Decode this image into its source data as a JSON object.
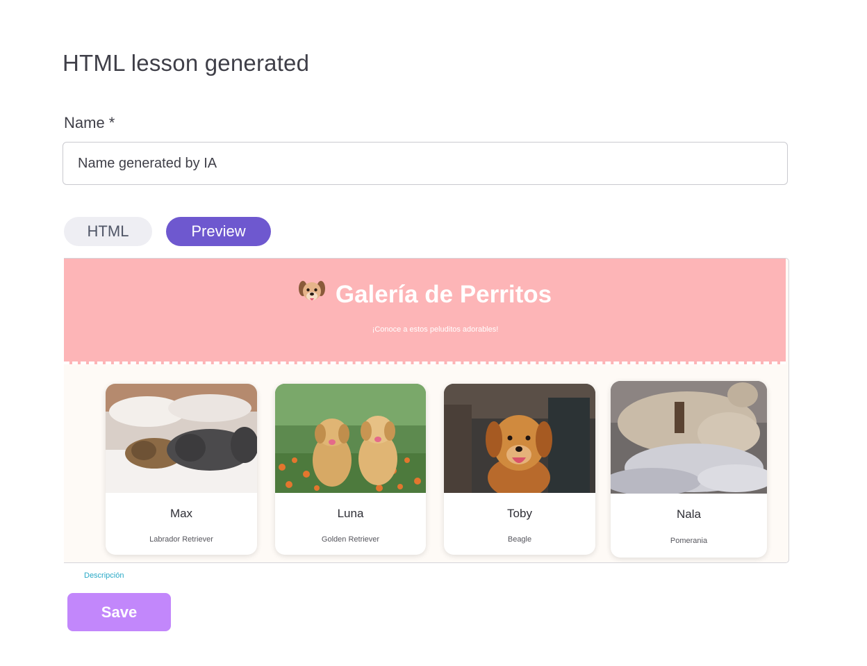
{
  "page": {
    "title": "HTML lesson generated"
  },
  "form": {
    "name_label": "Name *",
    "name_value": "Name generated by IA"
  },
  "tabs": [
    {
      "label": "HTML",
      "active": false
    },
    {
      "label": "Preview",
      "active": true
    }
  ],
  "preview": {
    "header": {
      "title": "Galería de Perritos",
      "subtitle": "¡Conoce a estos peluditos adorables!",
      "icon": "dog-face-icon"
    },
    "cards": [
      {
        "name": "Max",
        "breed": "Labrador Retriever",
        "photo": "sleeping-dogs-on-bed"
      },
      {
        "name": "Luna",
        "breed": "Golden Retriever",
        "photo": "two-puppies-in-flowers"
      },
      {
        "name": "Toby",
        "breed": "Beagle",
        "photo": "golden-dog-smiling"
      },
      {
        "name": "Nala",
        "breed": "Pomerania",
        "photo": "dog-sleeping-on-blanket"
      }
    ]
  },
  "footer": {
    "description_label": "Descripción",
    "save_label": "Save"
  },
  "colors": {
    "accent": "#6e58cf",
    "save": "#c287fb",
    "hero": "#fdb5b7",
    "link": "#27a8c6"
  }
}
